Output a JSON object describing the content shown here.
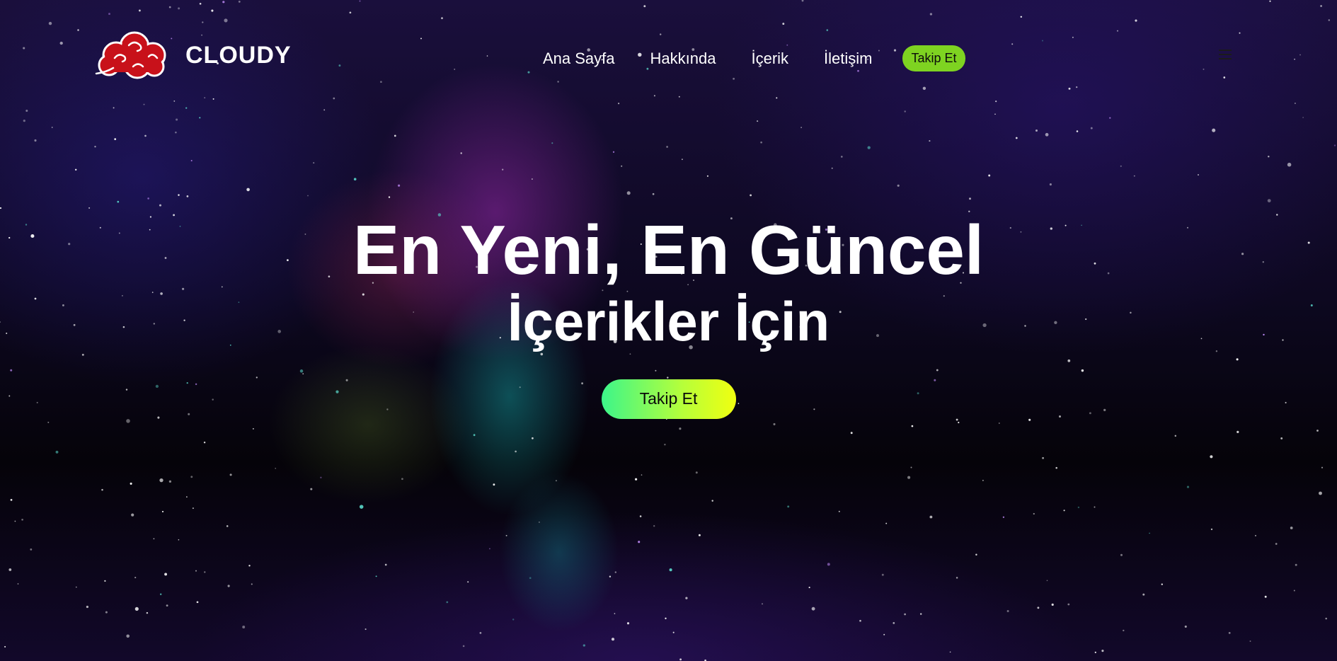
{
  "brand": {
    "name": "CLOUDY",
    "logo_icon": "red-cloud-icon",
    "logo_color": "#c8111a"
  },
  "nav": {
    "links": [
      "Ana Sayfa",
      "Hakkında",
      "İçerik",
      "İletişim"
    ],
    "cta_label": "Takip Et",
    "menu_icon": "hamburger-icon"
  },
  "hero": {
    "title_line1": "En Yeni, En Güncel",
    "title_line2": "İçerikler İçin",
    "cta_label": "Takip Et"
  },
  "colors": {
    "nav_cta_bg": "#7ed321",
    "hero_cta_gradient": [
      "#3cf58a",
      "#f0ff10"
    ],
    "text": "#ffffff"
  }
}
